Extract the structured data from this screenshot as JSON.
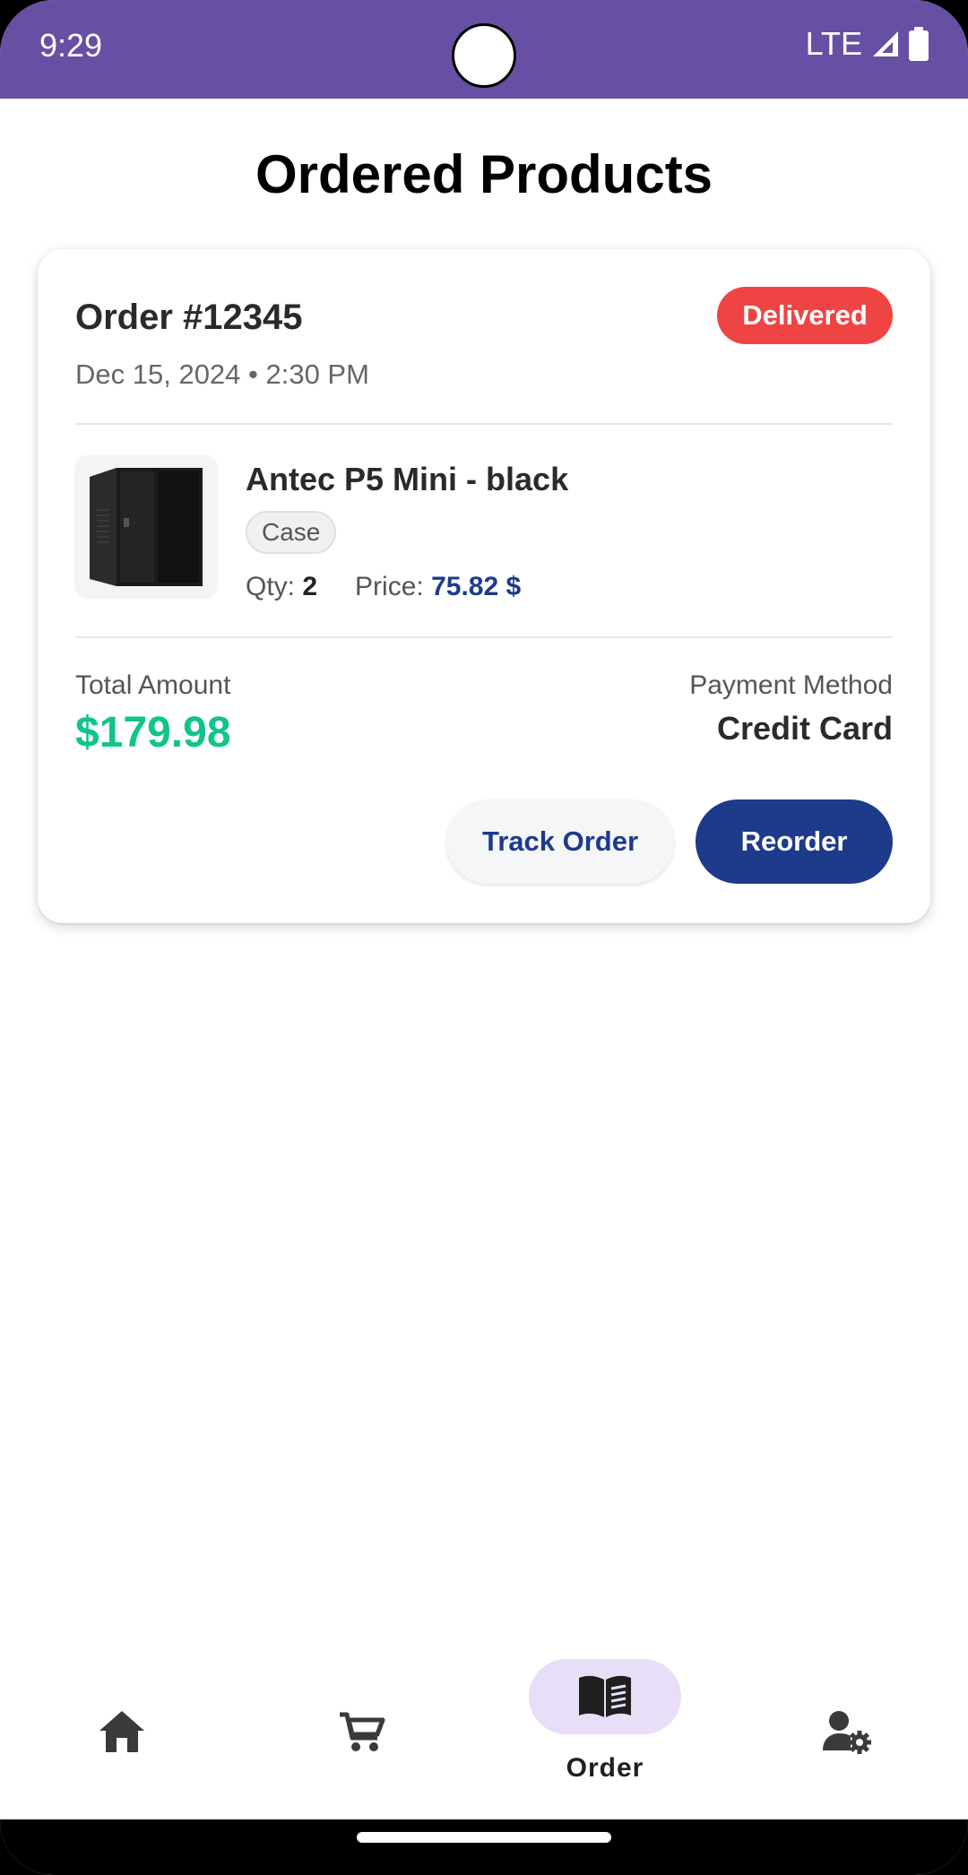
{
  "status_bar": {
    "time": "9:29",
    "network": "LTE"
  },
  "page": {
    "title": "Ordered Products"
  },
  "order": {
    "id_label": "Order #12345",
    "status": "Delivered",
    "date": "Dec 15, 2024 • 2:30 PM",
    "product": {
      "name": "Antec P5 Mini - black",
      "category": "Case",
      "qty_label": "Qty:",
      "qty_value": "2",
      "price_label": "Price:",
      "price_value": "75.82 $"
    },
    "total_label": "Total Amount",
    "total_value": "$179.98",
    "payment_label": "Payment Method",
    "payment_value": "Credit Card",
    "track_button": "Track Order",
    "reorder_button": "Reorder"
  },
  "bottom_nav": {
    "items": [
      {
        "icon": "home-icon",
        "label": ""
      },
      {
        "icon": "cart-icon",
        "label": ""
      },
      {
        "icon": "book-icon",
        "label": "Order"
      },
      {
        "icon": "user-settings-icon",
        "label": ""
      }
    ],
    "active_index": 2
  },
  "colors": {
    "status_bar": "#6750a4",
    "badge_delivered": "#ef4444",
    "primary_navy": "#1e3a8a",
    "total_green": "#10c48c",
    "nav_active_pill": "#e8def8"
  }
}
